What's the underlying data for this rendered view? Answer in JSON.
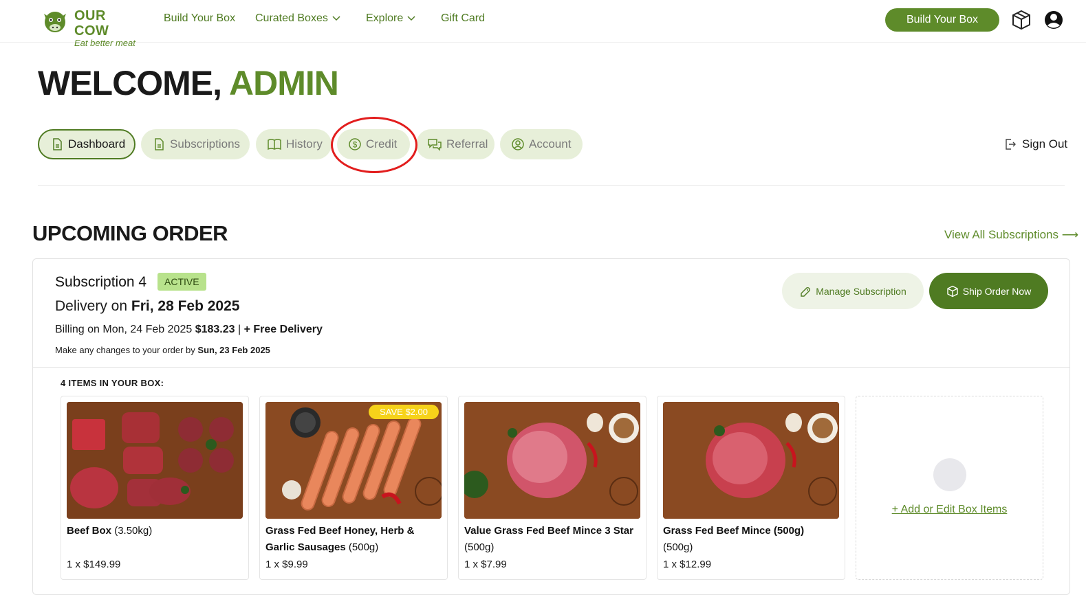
{
  "header": {
    "logo_title": "OUR COW",
    "logo_tagline": "Eat better meat",
    "nav": [
      {
        "label": "Build Your Box"
      },
      {
        "label": "Curated Boxes"
      },
      {
        "label": "Explore"
      },
      {
        "label": "Gift Card"
      }
    ],
    "cta_label": "Build Your Box"
  },
  "welcome": {
    "prefix": "WELCOME,",
    "name": "ADMIN"
  },
  "tabs": [
    {
      "label": "Dashboard",
      "active": true
    },
    {
      "label": "Subscriptions"
    },
    {
      "label": "History"
    },
    {
      "label": "Credit"
    },
    {
      "label": "Referral"
    },
    {
      "label": "Account"
    }
  ],
  "sign_out": "Sign Out",
  "upcoming": {
    "title": "UPCOMING ORDER",
    "view_all": "View All Subscriptions ⟶",
    "subscription_name": "Subscription 4",
    "status": "ACTIVE",
    "delivery_prefix": "Delivery on",
    "delivery_date": "Fri, 28 Feb 2025",
    "billing_prefix": "Billing on Mon, 24 Feb 2025",
    "billing_amount": "$183.23",
    "billing_sep": "|",
    "billing_delivery": "+ Free Delivery",
    "changes_prefix": "Make any changes to your order by",
    "changes_date": "Sun, 23 Feb 2025",
    "manage_label": "Manage Subscription",
    "ship_label": "Ship Order Now",
    "items_label": "4 ITEMS IN YOUR BOX:",
    "items": [
      {
        "name": "Beef Box",
        "size": "(3.50kg)",
        "price": "1 x $149.99"
      },
      {
        "name": "Grass Fed Beef Honey, Herb & Garlic Sausages",
        "size": "(500g)",
        "price": "1 x $9.99",
        "badge": "SAVE $2.00"
      },
      {
        "name": "Value Grass Fed Beef Mince 3 Star",
        "size": "(500g)",
        "price": "1 x $7.99"
      },
      {
        "name": "Grass Fed Beef Mince (500g)",
        "size": "(500g)",
        "price": "1 x $12.99"
      }
    ],
    "add_edit_label": "+ Add or Edit Box Items"
  },
  "colors": {
    "brand_green": "#5e8b2a",
    "dark_green": "#4f7b22",
    "highlight_red": "#e21d1d",
    "badge_active": "#b8e28c",
    "save_badge": "#f6d21a"
  }
}
